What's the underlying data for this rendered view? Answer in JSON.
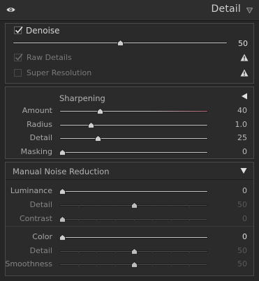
{
  "header": {
    "title": "Detail",
    "eye_icon": "eye-icon",
    "collapse_icon": "triangle-down-icon"
  },
  "denoise": {
    "label": "Denoise",
    "checked": true,
    "value": "50",
    "position": 0.5
  },
  "raw_details": {
    "label": "Raw Details",
    "checked": true,
    "icon": "warning-icon"
  },
  "super_resolution": {
    "label": "Super Resolution",
    "checked": false,
    "icon": "warning-icon"
  },
  "sharpening": {
    "title": "Sharpening",
    "toggle_icon": "triangle-left-icon",
    "sliders": [
      {
        "label": "Amount",
        "value": "40",
        "position": 0.27
      },
      {
        "label": "Radius",
        "value": "1.0",
        "position": 0.21
      },
      {
        "label": "Detail",
        "value": "25",
        "position": 0.26
      },
      {
        "label": "Masking",
        "value": "0",
        "position": 0.02
      }
    ]
  },
  "noise_reduction": {
    "title": "Manual Noise Reduction",
    "toggle_icon": "triangle-down-icon",
    "luminance": [
      {
        "label": "Luminance",
        "value": "0",
        "position": 0.02,
        "enabled": true
      },
      {
        "label": "Detail",
        "value": "50",
        "position": 0.5,
        "enabled": false
      },
      {
        "label": "Contrast",
        "value": "0",
        "position": 0.02,
        "enabled": false
      }
    ],
    "color": [
      {
        "label": "Color",
        "value": "0",
        "position": 0.02,
        "enabled": true
      },
      {
        "label": "Detail",
        "value": "50",
        "position": 0.5,
        "enabled": false
      },
      {
        "label": "Smoothness",
        "value": "50",
        "position": 0.5,
        "enabled": false
      }
    ]
  },
  "colors": {
    "accent_red": "#b86a78",
    "track": "#c8c8c8",
    "track_dim": "#4d4d4d"
  }
}
